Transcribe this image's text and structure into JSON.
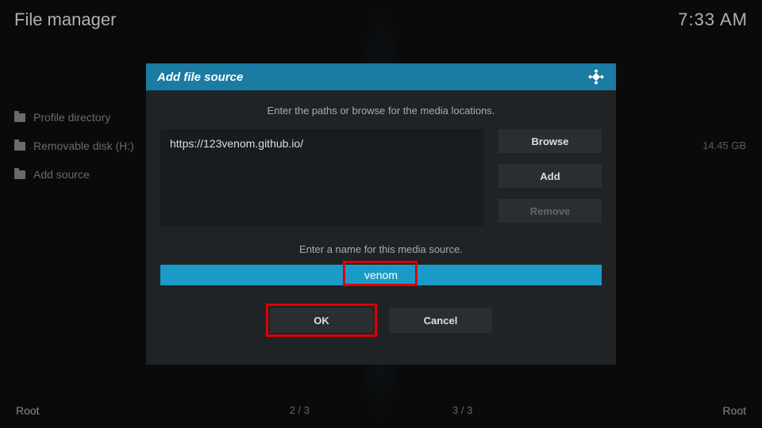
{
  "header": {
    "title": "File manager",
    "time": "7:33 AM"
  },
  "sidebar": {
    "items": [
      {
        "label": "Profile directory"
      },
      {
        "label": "Removable disk (H:)"
      },
      {
        "label": "Add source"
      }
    ]
  },
  "disk_size": "14.45 GB",
  "dialog": {
    "title": "Add file source",
    "instruction1": "Enter the paths or browse for the media locations.",
    "path_value": "https://123venom.github.io/",
    "browse_label": "Browse",
    "add_label": "Add",
    "remove_label": "Remove",
    "instruction2": "Enter a name for this media source.",
    "name_value": "venom",
    "ok_label": "OK",
    "cancel_label": "Cancel"
  },
  "footer": {
    "left": "Root",
    "mid1": "2 / 3",
    "mid2": "3 / 3",
    "right": "Root"
  }
}
